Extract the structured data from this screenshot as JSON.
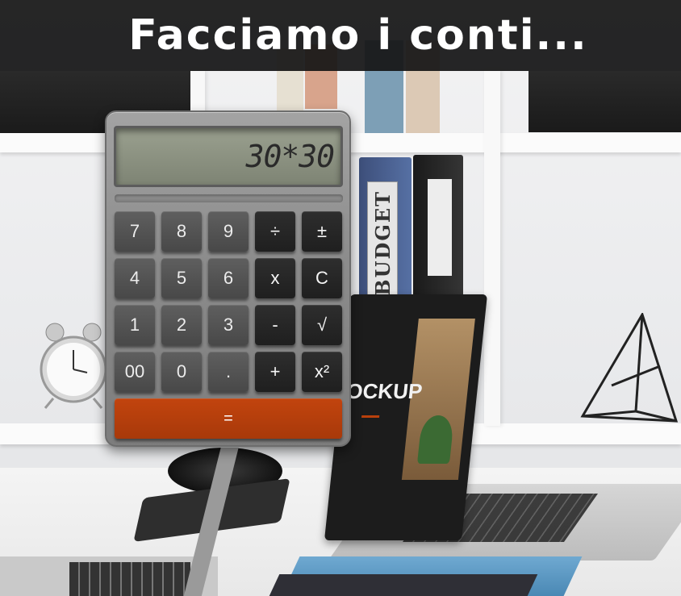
{
  "header": {
    "title": "Facciamo i conti..."
  },
  "calculator": {
    "display": "30*30",
    "keys": {
      "row1": [
        "7",
        "8",
        "9",
        "÷",
        "±"
      ],
      "row2": [
        "4",
        "5",
        "6",
        "x",
        "C"
      ],
      "row3": [
        "1",
        "2",
        "3",
        "-",
        "√"
      ],
      "row4": [
        "00",
        "0",
        ".",
        "+",
        "x²"
      ],
      "equals": "="
    }
  },
  "background": {
    "binder_spine_text": "BUDGET",
    "laptop_screen_text": "OCKUP",
    "accent_color": "#b8400c",
    "header_bg": "#161616"
  }
}
